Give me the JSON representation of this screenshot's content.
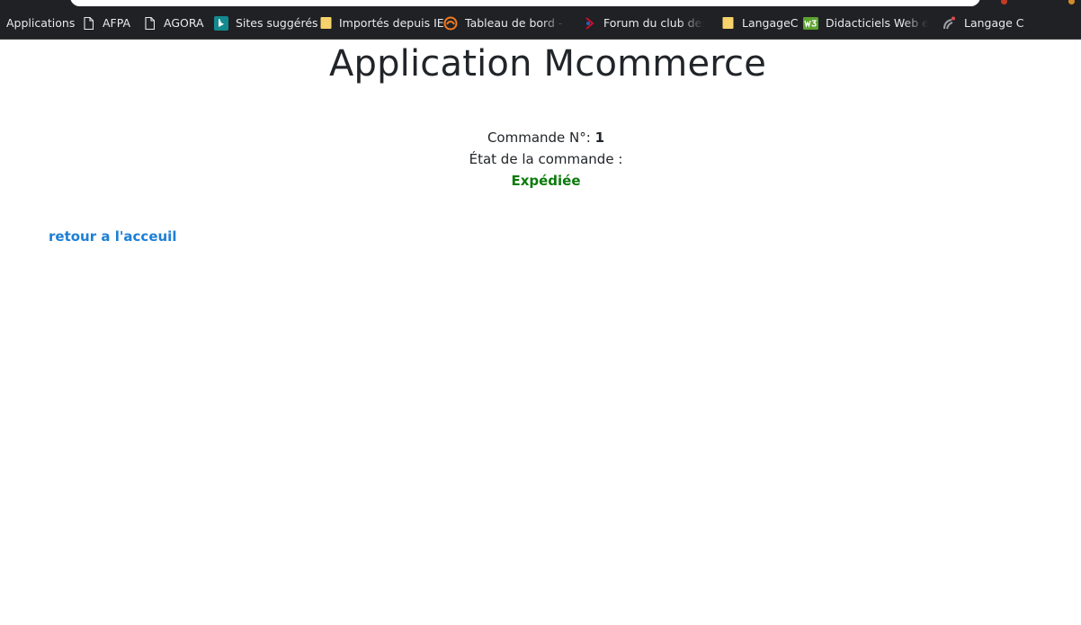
{
  "browser": {
    "bookmarks": [
      {
        "label": "Applications",
        "icon": "apps-icon"
      },
      {
        "label": "AFPA",
        "icon": "page-icon"
      },
      {
        "label": "AGORA",
        "icon": "page-icon"
      },
      {
        "label": "Sites suggérés",
        "icon": "bing-icon"
      },
      {
        "label": "Importés depuis IE",
        "icon": "folder-icon"
      },
      {
        "label": "Tableau de bord - Op",
        "icon": "moodle-icon"
      },
      {
        "label": "Forum du club des dé",
        "icon": "developpez-icon"
      },
      {
        "label": "LangageC",
        "icon": "folder-icon"
      },
      {
        "label": "Didacticiels Web en li",
        "icon": "w3-icon"
      },
      {
        "label": "Langage C",
        "icon": "openclassrooms-icon"
      }
    ]
  },
  "page": {
    "title": "Application Mcommerce",
    "order": {
      "number_label": "Commande N°:",
      "number_value": "1",
      "status_label": "État de la commande :",
      "status_value": "Expédiée"
    },
    "home_link": "retour a l'acceuil"
  },
  "colors": {
    "status": "#0b7a0b",
    "link": "#1d7fd6",
    "text": "#212529",
    "chrome": "#202124"
  }
}
